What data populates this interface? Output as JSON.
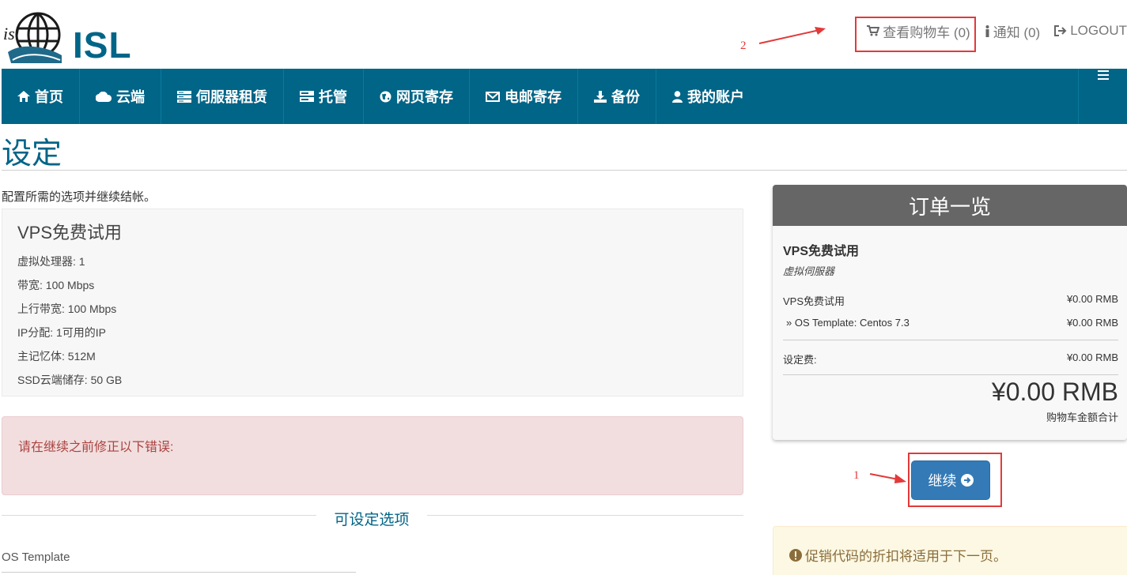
{
  "brand": {
    "name": "ISL",
    "mark_text": "isl"
  },
  "top_links": {
    "cart": "查看购物车 (0)",
    "notifications": "通知 (0)",
    "logout": "LOGOUT"
  },
  "annotations": {
    "cart_marker": "2",
    "continue_marker": "1"
  },
  "nav": {
    "items": [
      {
        "label": "首页",
        "icon": "home-icon"
      },
      {
        "label": "云端",
        "icon": "cloud-icon"
      },
      {
        "label": "伺服器租赁",
        "icon": "server-icon"
      },
      {
        "label": "托管",
        "icon": "hosting-icon"
      },
      {
        "label": "网页寄存",
        "icon": "globe-icon"
      },
      {
        "label": "电邮寄存",
        "icon": "envelope-icon"
      },
      {
        "label": "备份",
        "icon": "download-icon"
      },
      {
        "label": "我的账户",
        "icon": "user-icon"
      }
    ]
  },
  "page": {
    "title": "设定",
    "intro": "配置所需的选项并继续结帐。"
  },
  "product": {
    "name": "VPS免费试用",
    "specs": [
      "虚拟处理器: 1",
      "带宽: 100 Mbps",
      "上行带宽: 100 Mbps",
      "IP分配: 1可用的IP",
      "主记忆体: 512M",
      "SSD云端储存: 50 GB"
    ]
  },
  "error": {
    "message": "请在继续之前修正以下错误:"
  },
  "config": {
    "section_title": "可设定选项",
    "os_label": "OS Template"
  },
  "summary": {
    "title": "订单一览",
    "product_name": "VPS免费试用",
    "product_group": "虚拟伺服器",
    "rows": [
      {
        "label": "VPS免费试用",
        "value": "¥0.00 RMB"
      },
      {
        "label": "» OS Template: Centos 7.3",
        "value": "¥0.00 RMB"
      }
    ],
    "setup_fee": {
      "label": "设定费:",
      "value": "¥0.00 RMB"
    },
    "total": "¥0.00 RMB",
    "total_label": "购物车金额合计"
  },
  "continue_button": {
    "label": "继续"
  },
  "promo": {
    "message": "促销代码的折扣将适用于下一页。"
  },
  "colors": {
    "brand": "#006587",
    "button": "#337ab7",
    "annotation": "#e23a3a",
    "error_bg": "#f2dede",
    "warning_bg": "#fcf8e3"
  }
}
